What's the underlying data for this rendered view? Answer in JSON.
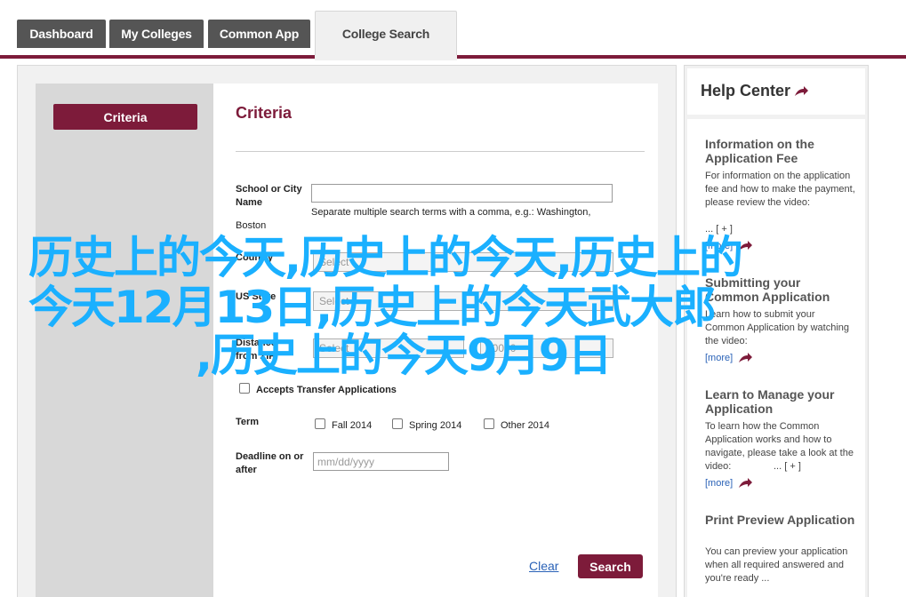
{
  "tabs": [
    {
      "label": "Dashboard",
      "active": false
    },
    {
      "label": "My Colleges",
      "active": false
    },
    {
      "label": "Common App",
      "active": false
    },
    {
      "label": "College Search",
      "active": true
    }
  ],
  "colors": {
    "brand": "#7d1b3a",
    "link": "#2a62b7",
    "overlay": "#1ab0ff"
  },
  "sidebar": {
    "criteria_button": "Criteria"
  },
  "form": {
    "title": "Criteria",
    "school_label": "School or City Name",
    "school_value": "",
    "school_hint": "Separate multiple search terms with a comma, e.g.: Washington,",
    "school_hint_2": "Boston",
    "country_label": "Country",
    "country_value": "Select",
    "state_label": "US State",
    "state_value": "Select",
    "distance_label": "Distance from ZIP",
    "distance_value": "Select",
    "zip_value": "00000",
    "transfer_label": "Accepts Transfer Applications",
    "term_label": "Term",
    "terms": [
      "Fall 2014",
      "Spring 2014",
      "Other 2014"
    ],
    "deadline_label": "Deadline on or after",
    "deadline_placeholder": "mm/dd/yyyy",
    "clear_label": "Clear",
    "search_label": "Search"
  },
  "help": {
    "title": "Help Center",
    "items": [
      {
        "title": "Information on the Application Fee",
        "text": "For information on the application fee and how to make the payment, please review the video:",
        "expand": "... [ + ]",
        "more": "[more]"
      },
      {
        "title": "Submitting your Common Application",
        "text": "Learn how to submit your Common Application by watching the video:",
        "expand": "",
        "more": "[more]"
      },
      {
        "title": "Learn to Manage your Application",
        "text": "To learn how the Common Application works and how to navigate, please take a look at the video:",
        "expand": "... [ + ]",
        "more": "[more]"
      },
      {
        "title": "Print Preview Application",
        "text": "You can preview your application when all required answered and you're ready ...",
        "expand": "",
        "more": ""
      }
    ]
  },
  "overlay": {
    "line1": "历史上的今天,历史上的今天,历史上的",
    "line2": "今天12月13日,历史上的今天武大郎",
    "line3": ",历史上的今天9月9日"
  }
}
